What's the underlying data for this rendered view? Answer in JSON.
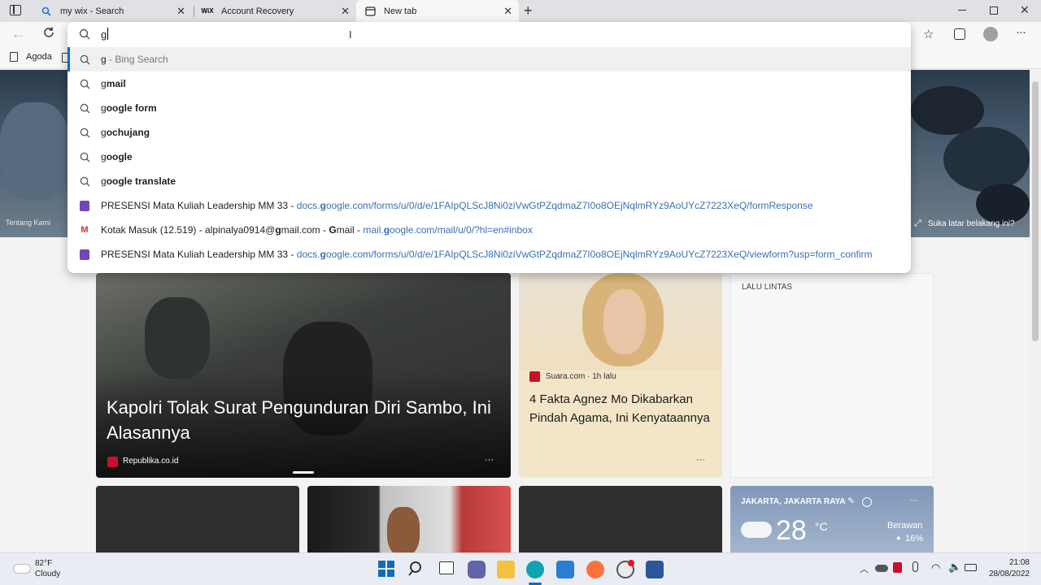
{
  "tabs": [
    {
      "title": "my wix - Search",
      "icon": "search-icon"
    },
    {
      "title": "Account Recovery",
      "icon": "wix-icon",
      "favicon_text": "WiX"
    },
    {
      "title": "New tab",
      "icon": "newtab-icon"
    }
  ],
  "address_bar": {
    "value": "g"
  },
  "bookmarks": [
    {
      "label": "Agoda"
    }
  ],
  "suggestions": [
    {
      "type": "search",
      "typed": "g",
      "rest": "",
      "suffix": " - Bing Search"
    },
    {
      "type": "search",
      "typed": "g",
      "rest": "mail"
    },
    {
      "type": "search",
      "typed": "g",
      "rest": "oogle form"
    },
    {
      "type": "search",
      "typed": "g",
      "rest": "ochujang"
    },
    {
      "type": "search",
      "typed": "g",
      "rest": "oogle"
    },
    {
      "type": "search",
      "typed": "g",
      "rest": "oogle translate"
    },
    {
      "type": "form",
      "title": "PRESENSI Mata Kuliah Leadership MM 33",
      "url_pre": "docs.",
      "url_bold": "g",
      "url_post": "oogle.com/forms/u/0/d/e/1FAIpQLScJ8Ni0ziVwGtPZqdmaZ7I0o8OEjNqlmRYz9AoUYcZ7223XeQ/formResponse"
    },
    {
      "type": "gmail",
      "title_pre": "Kotak Masuk (12.519) - alpinalya0914@",
      "title_bold": "g",
      "title_mid": "mail.com - ",
      "title_bold2": "G",
      "title_post": "mail",
      "url_pre": "mail.",
      "url_bold": "g",
      "url_post": "oogle.com/mail/u/0/?hl=en#inbox"
    },
    {
      "type": "form",
      "title": "PRESENSI Mata Kuliah Leadership MM 33",
      "url_pre": "docs.",
      "url_bold": "g",
      "url_post": "oogle.com/forms/u/0/d/e/1FAIpQLScJ8Ni0ziVwGtPZqdmaZ7I0o8OEjNqlmRYz9AoUYcZ7223XeQ/viewform?usp=form_confirm"
    }
  ],
  "hero": {
    "left_caption": "Tentang Kami",
    "right_caption": "Suka latar belakang ini?"
  },
  "cards": {
    "main": {
      "headline": "Kapolri Tolak Surat Pengunduran Diri Sambo, Ini Alasannya",
      "source": "Republika.co.id",
      "more": "···"
    },
    "second": {
      "source": "Suara.com · 1h lalu",
      "headline": "4 Fakta Agnez Mo Dikabarkan Pindah Agama, Ini Kenyataannya",
      "more": "···"
    },
    "traffic": {
      "label": "LALU LINTAS"
    },
    "weather": {
      "location": "JAKARTA, JAKARTA RAYA",
      "temp": "28",
      "unit": "°C",
      "condition": "Berawan",
      "humidity": "16%",
      "more": "···"
    }
  },
  "taskbar": {
    "weather_temp": "82°F",
    "weather_cond": "Cloudy",
    "time": "21:08",
    "date": "28/08/2022"
  }
}
